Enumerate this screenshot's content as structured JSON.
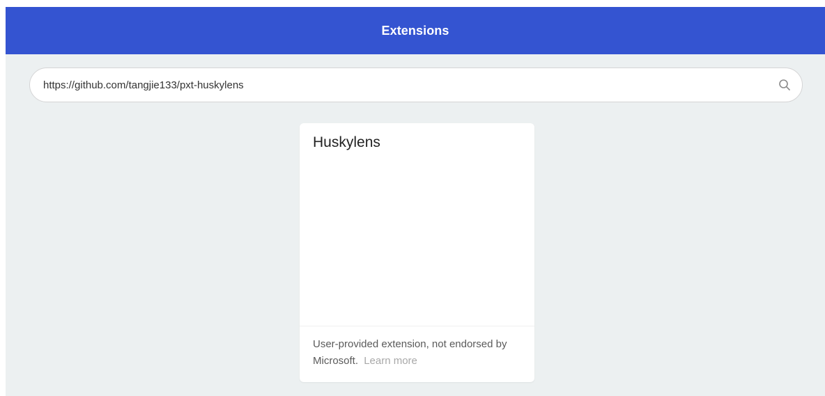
{
  "header": {
    "title": "Extensions"
  },
  "search": {
    "value": "https://github.com/tangjie133/pxt-huskylens",
    "icon": "search-icon"
  },
  "results": [
    {
      "title": "Huskylens",
      "footer_text": "User-provided extension, not endorsed by Microsoft.",
      "learn_more": "Learn more"
    }
  ],
  "colors": {
    "header_bg": "#3454d1",
    "page_bg": "#ecf0f1",
    "card_bg": "#ffffff"
  }
}
